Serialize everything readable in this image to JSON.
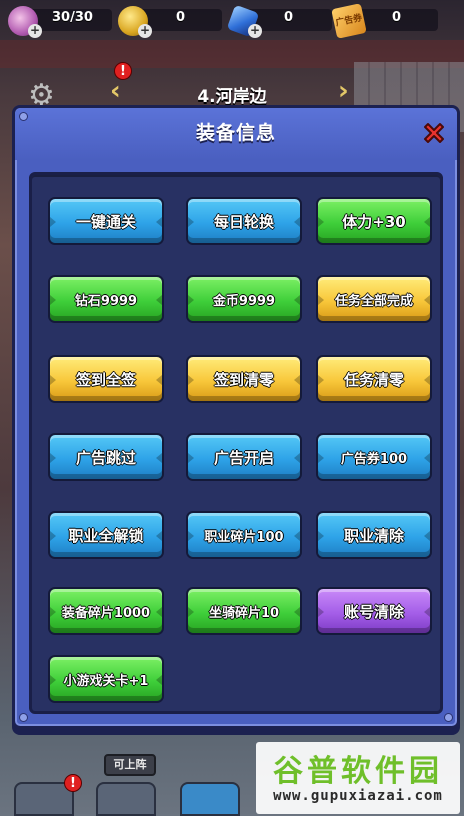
{
  "resources": {
    "stamina": "30/30",
    "coins": "0",
    "gems": "0",
    "ad_tickets": "0",
    "ad_icon_label": "广告券"
  },
  "stage": {
    "title": "4.河岸边"
  },
  "dialog": {
    "title": "装备信息",
    "buttons": [
      {
        "label": "一键通关",
        "color": "blue"
      },
      {
        "label": "每日轮换",
        "color": "blue"
      },
      {
        "label": "体力+30",
        "color": "green"
      },
      {
        "label": "钻石9999",
        "color": "green"
      },
      {
        "label": "金币9999",
        "color": "green"
      },
      {
        "label": "任务全部完成",
        "color": "yellow"
      },
      {
        "label": "签到全签",
        "color": "yellow"
      },
      {
        "label": "签到清零",
        "color": "yellow"
      },
      {
        "label": "任务清零",
        "color": "yellow"
      },
      {
        "label": "广告跳过",
        "color": "blue"
      },
      {
        "label": "广告开启",
        "color": "blue"
      },
      {
        "label": "广告券100",
        "color": "blue"
      },
      {
        "label": "职业全解锁",
        "color": "blue"
      },
      {
        "label": "职业碎片100",
        "color": "blue"
      },
      {
        "label": "职业清除",
        "color": "blue"
      },
      {
        "label": "装备碎片1000",
        "color": "green"
      },
      {
        "label": "坐骑碎片10",
        "color": "green"
      },
      {
        "label": "账号清除",
        "color": "purple"
      },
      {
        "label": "小游戏关卡+1",
        "color": "green"
      }
    ]
  },
  "bottom": {
    "go_label": "可上阵"
  },
  "watermark": {
    "name": "谷普软件园",
    "url": "www.gupuxiazai.com"
  },
  "colors": {
    "dialog_bg": "#4a5fc0",
    "inner_bg": "#283163",
    "blue": "#2ea3e8",
    "green": "#3fcf3a",
    "yellow": "#f8c73a",
    "purple": "#a45ee8",
    "close": "#e8322e"
  }
}
